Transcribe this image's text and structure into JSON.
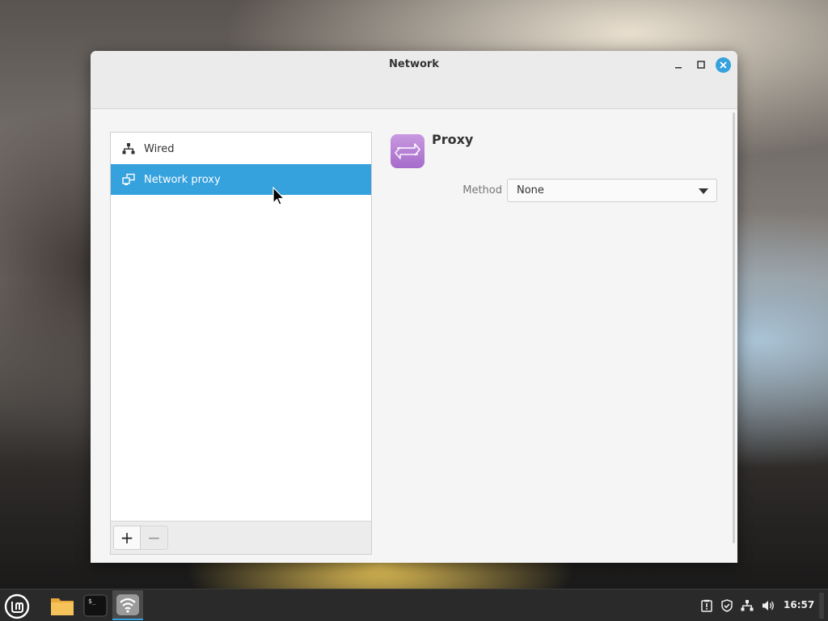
{
  "window": {
    "title": "Network"
  },
  "connections": {
    "items": [
      {
        "label": "Wired",
        "icon": "wired-network-icon",
        "selected": false
      },
      {
        "label": "Network proxy",
        "icon": "network-proxy-icon",
        "selected": true
      }
    ],
    "add_label": "+",
    "remove_label": "−"
  },
  "proxy": {
    "title": "Proxy",
    "icon": "proxy-arrows-icon",
    "method_label": "Method",
    "method_value": "None"
  },
  "taskbar": {
    "clock": "16:57",
    "apps": [
      "mint-menu-icon",
      "files-folder-icon",
      "terminal-icon",
      "network-wifi-icon"
    ],
    "tray": [
      "update-manager-icon",
      "shield-icon",
      "network-tray-icon",
      "volume-icon"
    ]
  },
  "colors": {
    "accent": "#35a1dd",
    "proxy_icon": "#b07ad4"
  }
}
